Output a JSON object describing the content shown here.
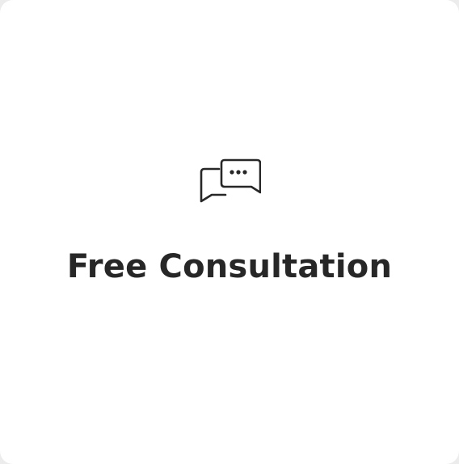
{
  "card": {
    "title": "Free Consultation",
    "icon": "chat-bubbles-icon"
  },
  "colors": {
    "background": "#ffffff",
    "text": "#272727",
    "icon": "#272727"
  }
}
